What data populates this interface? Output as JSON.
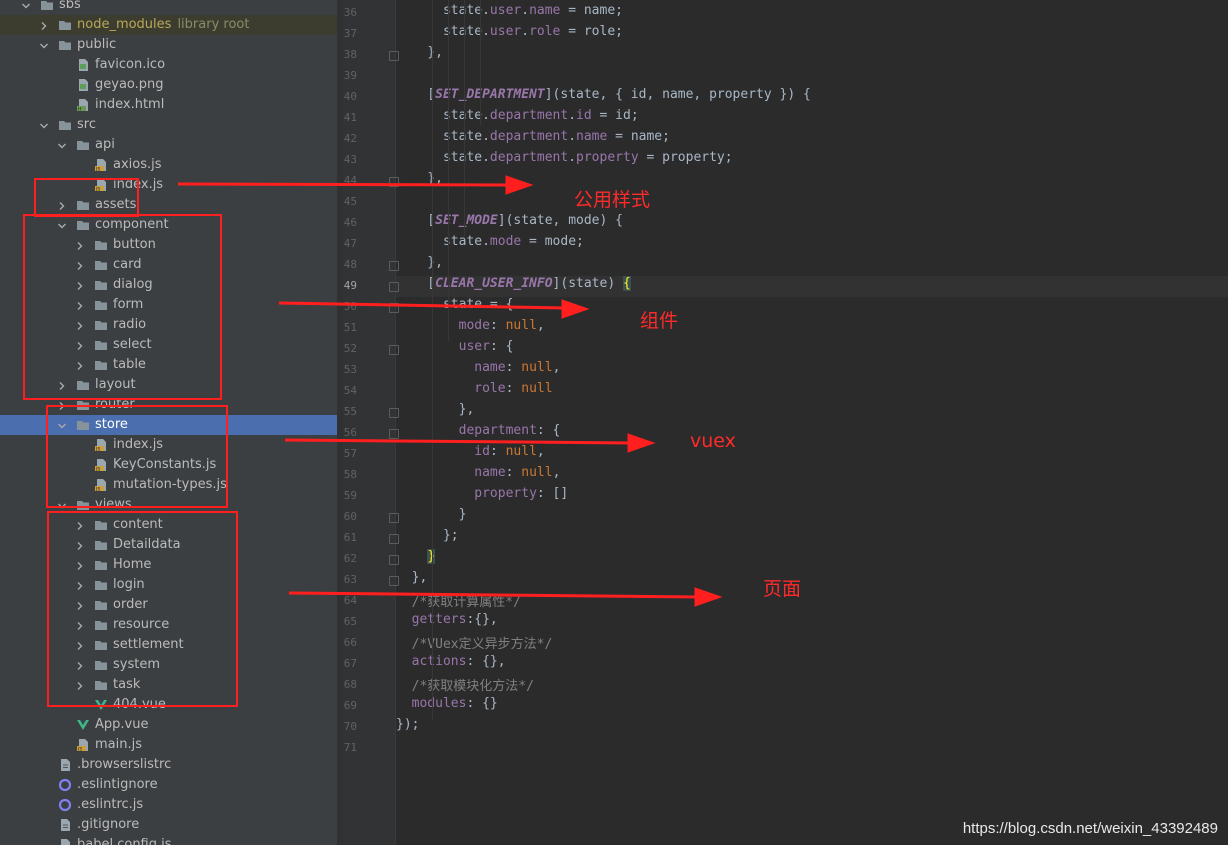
{
  "tree": {
    "rows": [
      {
        "label": "sbs",
        "type": "folder",
        "expanded": true,
        "level": 0
      },
      {
        "label": "node_modules",
        "hint": "library root",
        "type": "folder",
        "expanded": false,
        "level": 1,
        "lib": true
      },
      {
        "label": "public",
        "type": "folder",
        "expanded": true,
        "level": 1
      },
      {
        "label": "favicon.ico",
        "type": "file-img",
        "level": 2
      },
      {
        "label": "geyao.png",
        "type": "file-img",
        "level": 2
      },
      {
        "label": "index.html",
        "type": "file-html",
        "level": 2
      },
      {
        "label": "src",
        "type": "folder",
        "expanded": true,
        "level": 1
      },
      {
        "label": "api",
        "type": "folder",
        "expanded": true,
        "level": 2
      },
      {
        "label": "axios.js",
        "type": "file-js",
        "level": 3
      },
      {
        "label": "index.js",
        "type": "file-js",
        "level": 3
      },
      {
        "label": "assets",
        "type": "folder",
        "expanded": false,
        "level": 2
      },
      {
        "label": "component",
        "type": "folder",
        "expanded": true,
        "level": 2
      },
      {
        "label": "button",
        "type": "folder",
        "expanded": false,
        "level": 3
      },
      {
        "label": "card",
        "type": "folder",
        "expanded": false,
        "level": 3
      },
      {
        "label": "dialog",
        "type": "folder",
        "expanded": false,
        "level": 3
      },
      {
        "label": "form",
        "type": "folder",
        "expanded": false,
        "level": 3
      },
      {
        "label": "radio",
        "type": "folder",
        "expanded": false,
        "level": 3
      },
      {
        "label": "select",
        "type": "folder",
        "expanded": false,
        "level": 3
      },
      {
        "label": "table",
        "type": "folder",
        "expanded": false,
        "level": 3
      },
      {
        "label": "layout",
        "type": "folder",
        "expanded": false,
        "level": 2
      },
      {
        "label": "router",
        "type": "folder",
        "expanded": false,
        "level": 2
      },
      {
        "label": "store",
        "type": "folder",
        "expanded": true,
        "level": 2,
        "selected": true
      },
      {
        "label": "index.js",
        "type": "file-js",
        "level": 3
      },
      {
        "label": "KeyConstants.js",
        "type": "file-js",
        "level": 3
      },
      {
        "label": "mutation-types.js",
        "type": "file-js",
        "level": 3
      },
      {
        "label": "views",
        "type": "folder",
        "expanded": true,
        "level": 2
      },
      {
        "label": "content",
        "type": "folder",
        "expanded": false,
        "level": 3
      },
      {
        "label": "Detaildata",
        "type": "folder",
        "expanded": false,
        "level": 3
      },
      {
        "label": "Home",
        "type": "folder",
        "expanded": false,
        "level": 3
      },
      {
        "label": "login",
        "type": "folder",
        "expanded": false,
        "level": 3
      },
      {
        "label": "order",
        "type": "folder",
        "expanded": false,
        "level": 3
      },
      {
        "label": "resource",
        "type": "folder",
        "expanded": false,
        "level": 3
      },
      {
        "label": "settlement",
        "type": "folder",
        "expanded": false,
        "level": 3
      },
      {
        "label": "system",
        "type": "folder",
        "expanded": false,
        "level": 3
      },
      {
        "label": "task",
        "type": "folder",
        "expanded": false,
        "level": 3
      },
      {
        "label": "404.vue",
        "type": "file-vue",
        "level": 3
      },
      {
        "label": "App.vue",
        "type": "file-vue",
        "level": 2
      },
      {
        "label": "main.js",
        "type": "file-js",
        "level": 2
      },
      {
        "label": ".browserslistrc",
        "type": "file-cfg",
        "level": 1
      },
      {
        "label": ".eslintignore",
        "type": "file-eslint",
        "level": 1
      },
      {
        "label": ".eslintrc.js",
        "type": "file-eslint",
        "level": 1
      },
      {
        "label": ".gitignore",
        "type": "file-cfg",
        "level": 1
      },
      {
        "label": "babel.config.js",
        "type": "file-js",
        "level": 1
      }
    ]
  },
  "editor": {
    "current_line": 49,
    "lines": [
      {
        "n": 36,
        "tokens": [
          [
            "      state.",
            ""
          ],
          [
            "user",
            "p"
          ],
          [
            ".",
            ""
          ],
          [
            "name",
            "p"
          ],
          [
            " = name;",
            ""
          ]
        ]
      },
      {
        "n": 37,
        "tokens": [
          [
            "      state.",
            ""
          ],
          [
            "user",
            "p"
          ],
          [
            ".",
            ""
          ],
          [
            "role",
            "p"
          ],
          [
            " = role;",
            ""
          ]
        ]
      },
      {
        "n": 38,
        "tokens": [
          [
            "    },",
            ""
          ]
        ]
      },
      {
        "n": 39,
        "tokens": []
      },
      {
        "n": 40,
        "tokens": [
          [
            "    [",
            ""
          ],
          [
            "SET_DEPARTMENT",
            "c"
          ],
          [
            "](state, { id, name, property }) {",
            ""
          ]
        ]
      },
      {
        "n": 41,
        "tokens": [
          [
            "      state.",
            ""
          ],
          [
            "department",
            "p"
          ],
          [
            ".",
            ""
          ],
          [
            "id",
            "p"
          ],
          [
            " = id;",
            ""
          ]
        ]
      },
      {
        "n": 42,
        "tokens": [
          [
            "      state.",
            ""
          ],
          [
            "department",
            "p"
          ],
          [
            ".",
            ""
          ],
          [
            "name",
            "p"
          ],
          [
            " = name;",
            ""
          ]
        ]
      },
      {
        "n": 43,
        "tokens": [
          [
            "      state.",
            ""
          ],
          [
            "department",
            "p"
          ],
          [
            ".",
            ""
          ],
          [
            "property",
            "p"
          ],
          [
            " = property;",
            ""
          ]
        ]
      },
      {
        "n": 44,
        "tokens": [
          [
            "    },",
            ""
          ]
        ]
      },
      {
        "n": 45,
        "tokens": []
      },
      {
        "n": 46,
        "tokens": [
          [
            "    [",
            ""
          ],
          [
            "SET_MODE",
            "c"
          ],
          [
            "](state, mode) {",
            ""
          ]
        ]
      },
      {
        "n": 47,
        "tokens": [
          [
            "      state.",
            ""
          ],
          [
            "mode",
            "p"
          ],
          [
            " = mode;",
            ""
          ]
        ]
      },
      {
        "n": 48,
        "tokens": [
          [
            "    },",
            ""
          ]
        ]
      },
      {
        "n": 49,
        "tokens": [
          [
            "    [",
            ""
          ],
          [
            "CLEAR_USER_INFO",
            "c"
          ],
          [
            "](state) ",
            ""
          ],
          [
            "{",
            "b"
          ]
        ]
      },
      {
        "n": 50,
        "tokens": [
          [
            "      state = {",
            ""
          ]
        ]
      },
      {
        "n": 51,
        "tokens": [
          [
            "        ",
            ""
          ],
          [
            "mode",
            "p"
          ],
          [
            ": ",
            ""
          ],
          [
            "null",
            "k"
          ],
          [
            ",",
            ""
          ]
        ]
      },
      {
        "n": 52,
        "tokens": [
          [
            "        ",
            ""
          ],
          [
            "user",
            "p"
          ],
          [
            ": {",
            ""
          ]
        ]
      },
      {
        "n": 53,
        "tokens": [
          [
            "          ",
            ""
          ],
          [
            "name",
            "p"
          ],
          [
            ": ",
            ""
          ],
          [
            "null",
            "k"
          ],
          [
            ",",
            ""
          ]
        ]
      },
      {
        "n": 54,
        "tokens": [
          [
            "          ",
            ""
          ],
          [
            "role",
            "p"
          ],
          [
            ": ",
            ""
          ],
          [
            "null",
            "k"
          ]
        ]
      },
      {
        "n": 55,
        "tokens": [
          [
            "        },",
            ""
          ]
        ]
      },
      {
        "n": 56,
        "tokens": [
          [
            "        ",
            ""
          ],
          [
            "department",
            "p"
          ],
          [
            ": {",
            ""
          ]
        ]
      },
      {
        "n": 57,
        "tokens": [
          [
            "          ",
            ""
          ],
          [
            "id",
            "p"
          ],
          [
            ": ",
            ""
          ],
          [
            "null",
            "k"
          ],
          [
            ",",
            ""
          ]
        ]
      },
      {
        "n": 58,
        "tokens": [
          [
            "          ",
            ""
          ],
          [
            "name",
            "p"
          ],
          [
            ": ",
            ""
          ],
          [
            "null",
            "k"
          ],
          [
            ",",
            ""
          ]
        ]
      },
      {
        "n": 59,
        "tokens": [
          [
            "          ",
            ""
          ],
          [
            "property",
            "p"
          ],
          [
            ": []",
            ""
          ]
        ]
      },
      {
        "n": 60,
        "tokens": [
          [
            "        }",
            ""
          ]
        ]
      },
      {
        "n": 61,
        "tokens": [
          [
            "      };",
            ""
          ]
        ]
      },
      {
        "n": 62,
        "tokens": [
          [
            "    ",
            ""
          ],
          [
            "}",
            "b"
          ]
        ]
      },
      {
        "n": 63,
        "tokens": [
          [
            "  },",
            ""
          ]
        ]
      },
      {
        "n": 64,
        "tokens": [
          [
            "  /*获取计算属性*/",
            "m"
          ]
        ]
      },
      {
        "n": 65,
        "tokens": [
          [
            "  ",
            ""
          ],
          [
            "getters",
            "p"
          ],
          [
            ":{},",
            ""
          ]
        ]
      },
      {
        "n": 66,
        "tokens": [
          [
            "  /*VUex定义异步方法*/",
            "m"
          ]
        ]
      },
      {
        "n": 67,
        "tokens": [
          [
            "  ",
            ""
          ],
          [
            "actions",
            "p"
          ],
          [
            ": {},",
            ""
          ]
        ]
      },
      {
        "n": 68,
        "tokens": [
          [
            "  /*获取模块化方法*/",
            "m"
          ]
        ]
      },
      {
        "n": 69,
        "tokens": [
          [
            "  ",
            ""
          ],
          [
            "modules",
            "p"
          ],
          [
            ": {}",
            ""
          ]
        ]
      },
      {
        "n": 70,
        "tokens": [
          [
            "});",
            ""
          ]
        ]
      },
      {
        "n": 71,
        "tokens": []
      }
    ]
  },
  "annotations": {
    "note_public_style": "公用样式",
    "note_component": "组件",
    "note_vuex": "vuex",
    "note_page": "页面",
    "color": "#ff1f1f"
  },
  "watermark": "https://blog.csdn.net/weixin_43392489"
}
